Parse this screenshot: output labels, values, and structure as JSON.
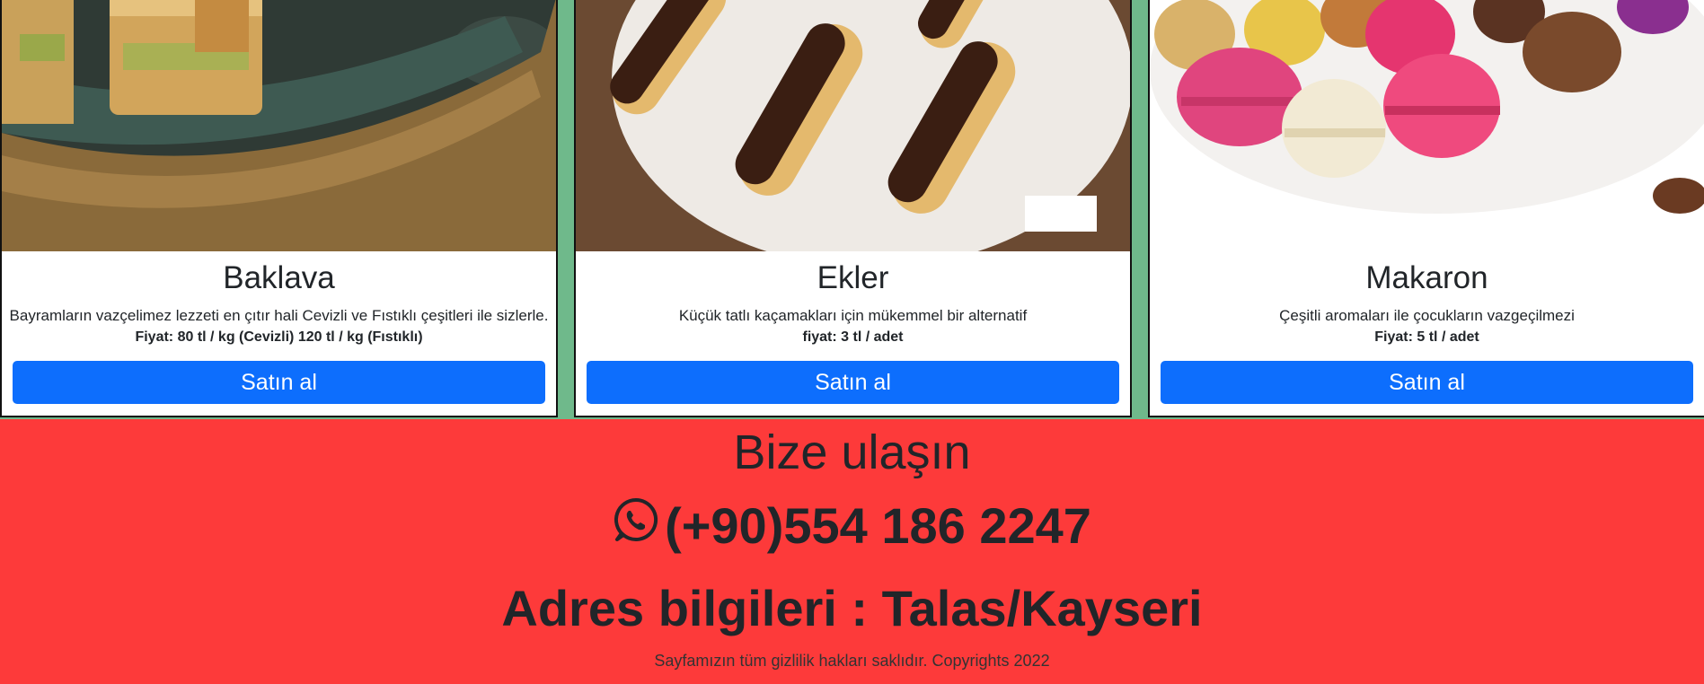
{
  "products": [
    {
      "title": "Baklava",
      "description": "Bayramların vazçelimez lezzeti en çıtır hali Cevizli ve Fıstıklı çeşitleri ile sizlerle.",
      "price": "Fiyat: 80 tl / kg (Cevizli) 120 tl / kg (Fıstıklı)",
      "button_label": "Satın al",
      "image": "baklava-photo"
    },
    {
      "title": "Ekler",
      "description": "Küçük tatlı kaçamakları için mükemmel bir alternatif",
      "price": "fiyat: 3 tl / adet",
      "button_label": "Satın al",
      "image": "ekler-photo"
    },
    {
      "title": "Makaron",
      "description": "Çeşitli aromaları ile çocukların vazgeçilmezi",
      "price": "Fiyat: 5 tl / adet",
      "button_label": "Satın al",
      "image": "makaron-photo"
    }
  ],
  "footer": {
    "contact_title": "Bize ulaşın",
    "phone": "(+90)554 186 2247",
    "phone_icon": "whatsapp-icon",
    "address": "Adres bilgileri : Talas/Kayseri",
    "copyright": "Sayfamızın tüm gizlilik hakları saklıdır. Copyrights 2022"
  },
  "colors": {
    "page_bg": "#6fb98b",
    "footer_bg": "#fd3a3a",
    "button_bg": "#0d6efd",
    "text": "#212529"
  }
}
